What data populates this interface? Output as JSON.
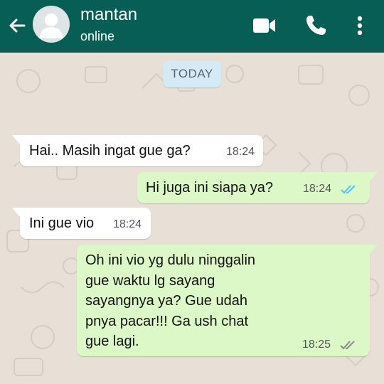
{
  "header": {
    "contact_name": "mantan",
    "status": "online",
    "icons": [
      "back-arrow-icon",
      "avatar-placeholder",
      "video-call-icon",
      "phone-call-icon",
      "more-options-icon"
    ]
  },
  "chat": {
    "date_label": "TODAY",
    "messages": [
      {
        "direction": "incoming",
        "text": "Hai.. Masih ingat gue ga?",
        "time": "18:24"
      },
      {
        "direction": "outgoing",
        "text": "Hi juga ini siapa ya?",
        "time": "18:24",
        "status": "read"
      },
      {
        "direction": "incoming",
        "text": "Ini gue vio",
        "time": "18:24"
      },
      {
        "direction": "outgoing",
        "text": "Oh ini vio yg dulu ninggalin\ngue waktu lg sayang\nsayangnya ya? Gue udah\npnya pacar!!! Ga ush chat\ngue lagi.",
        "time": "18:25",
        "status": "delivered"
      }
    ]
  },
  "colors": {
    "header_bg": "#075e54",
    "chat_bg": "#e5ddd5",
    "incoming_bubble": "#ffffff",
    "outgoing_bubble": "#dcf8c6",
    "date_chip": "#d4eaf4",
    "read_ticks": "#4fc3f7",
    "delivered_ticks": "#8a8a8a"
  }
}
